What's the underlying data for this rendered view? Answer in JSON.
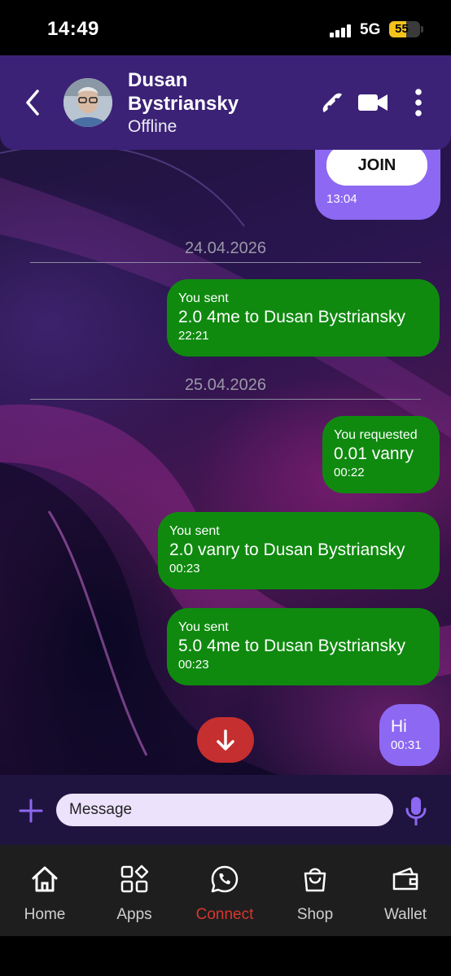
{
  "status_bar": {
    "time": "14:49",
    "network": "5G",
    "battery": "55",
    "battery_level": 0.55
  },
  "header": {
    "name": "Dusan Bystriansky",
    "status": "Offline"
  },
  "join_message": {
    "button_label": "JOIN",
    "time": "13:04"
  },
  "dates": [
    "24.04.2026",
    "25.04.2026"
  ],
  "messages": [
    {
      "title": "You sent",
      "text": "2.0 4me to Dusan Bystriansky",
      "time": "22:21"
    },
    {
      "title": "You requested",
      "text": "0.01 vanry",
      "time": "00:22"
    },
    {
      "title": "You sent",
      "text": "2.0 vanry to Dusan Bystriansky",
      "time": "00:23"
    },
    {
      "title": "You sent",
      "text": "5.0 4me to Dusan Bystriansky",
      "time": "00:23"
    },
    {
      "text": "Hi",
      "time": "00:31"
    }
  ],
  "composer": {
    "placeholder": "Message"
  },
  "nav": [
    {
      "label": "Home",
      "icon": "home-icon"
    },
    {
      "label": "Apps",
      "icon": "apps-icon"
    },
    {
      "label": "Connect",
      "icon": "connect-icon",
      "active": true
    },
    {
      "label": "Shop",
      "icon": "shop-icon"
    },
    {
      "label": "Wallet",
      "icon": "wallet-icon"
    }
  ],
  "colors": {
    "header": "#3b2276",
    "sent_bubble": "#0f8a0f",
    "own_bubble": "#8d68f2",
    "accent_red": "#d9362f",
    "scroll_button": "#c62f2f"
  }
}
